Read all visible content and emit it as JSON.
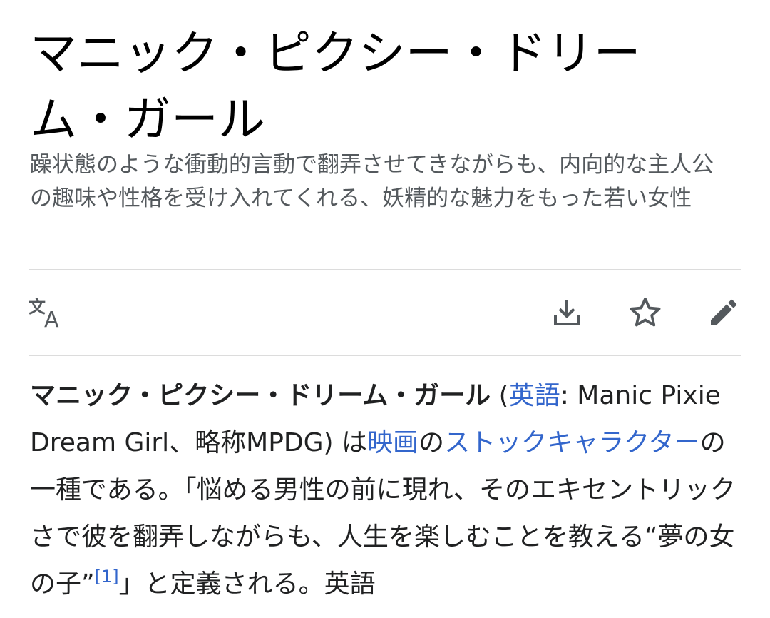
{
  "article": {
    "title": "マニック・ピクシー・ドリーム・ガール",
    "description": "躁状態のような衝動的言動で翻弄させてきながらも、内向的な主人公の趣味や性格を受け入れてくれる、妖精的な魅力をもった若い女性"
  },
  "toolbar": {
    "language_icon": "translate-icon",
    "download_icon": "download-icon",
    "watch_icon": "star-icon",
    "edit_icon": "pencil-icon",
    "icon_color": "#54595d"
  },
  "paragraph": {
    "term": "マニック・ピクシー・ドリーム・ガール",
    "paren_open": " (",
    "lang_link": "英語",
    "original_text": ": Manic Pixie Dream Girl、略称MPDG) は",
    "film_link": "映画",
    "of_text": "の",
    "stock_character_link": "ストックキャラクター",
    "definition_text": "の一種である。「悩める男性の前に現れ、そのエキセントリックさで彼を翻弄しながらも、人生を楽しむことを教える“夢の女の子”",
    "citation": "[1]",
    "closing_text": "」と定義される。英語"
  },
  "colors": {
    "link": "#3366cc",
    "text": "#202122",
    "subtle_text": "#54595d",
    "divider": "#dcdcdc"
  }
}
